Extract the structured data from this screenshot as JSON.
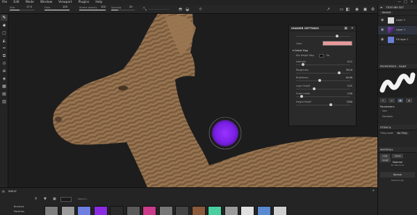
{
  "menu": [
    "File",
    "Edit",
    "Mode",
    "Window",
    "Viewport",
    "Plugins",
    "Help"
  ],
  "window_controls": [
    "—",
    "□",
    "✕"
  ],
  "toolbar": {
    "size_label": "Size",
    "size_value": "17.5",
    "flow_label": "Flow",
    "flow_value": "100",
    "stroke_label": "Stroke opacity",
    "stroke_value": "100",
    "spacing_label": "Spacing",
    "spacing_value": "20",
    "material_dropdown": "Material"
  },
  "shader_panel": {
    "title": "SHADER SETTINGS",
    "color_label": "Color",
    "color_hex": "#e89a9a",
    "section": "Detail Map",
    "rows": [
      {
        "label": "Mix Height Map",
        "value": "Fx"
      },
      {
        "label": "Intensity",
        "value": "0.11",
        "level": 0.12
      },
      {
        "label": "Roughness",
        "value": "76.10",
        "level": 0.76
      },
      {
        "label": "Brightness",
        "value": "40.00",
        "level": 0.4
      },
      {
        "label": "Layer Falloff",
        "value": "3.21",
        "level": 0.32
      },
      {
        "label": "Scale Limits",
        "value": "2.50",
        "level": 0.25
      },
      {
        "label": "Height Falloff",
        "value": "2350",
        "level": 0.6
      }
    ]
  },
  "right_panel": {
    "tab_title": "TEXTURE SET",
    "blend_mode": "Normal",
    "layers": [
      {
        "name": "Layer 2",
        "color": "#d9d9d9"
      },
      {
        "name": "Layer 1",
        "color": "#8a3fd8"
      },
      {
        "name": "Fill layer 1",
        "color": "#6a7fd8"
      }
    ],
    "properties_title": "PROPERTIES - PAINT",
    "parameters_title": "Parameters",
    "param_rows": [
      "Size",
      "Hardness"
    ],
    "stencil_title": "STENCIL",
    "tiling_label": "Tiling mode",
    "tiling_value": "No Tiling",
    "material_title": "MATERIAL",
    "material_modes": [
      "color",
      "metal",
      "rough"
    ],
    "material_label": "Material",
    "resource_label": "No Resource",
    "normal_label": "Normal",
    "passthrough_label": "Passthrough"
  },
  "shelf": {
    "title": "SHELF",
    "categories": [
      "Brushes",
      "Particles"
    ],
    "search_placeholder": "Search...",
    "swatch_colors": [
      "#7e7e7e",
      "#9a9a9a",
      "#6f7fe0",
      "#8a2be2",
      "#2a2a2a",
      "#5a5a5a",
      "#cc3a8a",
      "#777777",
      "#444444",
      "#8a5a3a",
      "#4ad0a0",
      "#9b9b9b",
      "#e0e0e0",
      "#5a8ad0",
      "#cfcfcf"
    ]
  },
  "colors": {
    "brush_cursor": "#8a2be2",
    "wood": "#8a6a4a"
  }
}
